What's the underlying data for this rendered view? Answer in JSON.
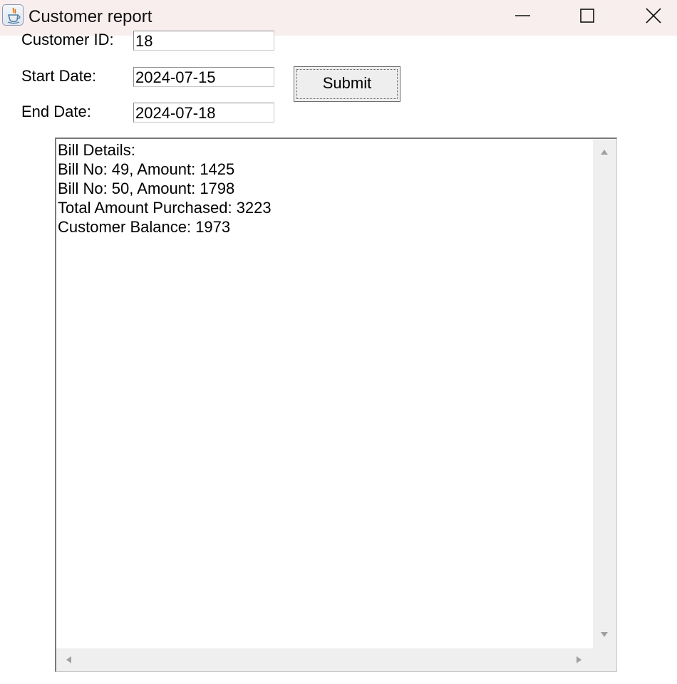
{
  "window": {
    "title": "Customer report",
    "app_icon": "java-icon"
  },
  "form": {
    "customer_id_label": "Customer ID:",
    "customer_id_value": "18",
    "start_date_label": "Start Date:",
    "start_date_value": "2024-07-15",
    "end_date_label": "End Date:",
    "end_date_value": "2024-07-18",
    "submit_label": "Submit"
  },
  "report": {
    "lines": [
      "Bill Details:",
      "Bill No: 49, Amount: 1425",
      "Bill No: 50, Amount: 1798",
      "Total Amount Purchased: 3223",
      "Customer Balance: 1973"
    ]
  },
  "colors": {
    "titlebar_bg": "#f9eeee",
    "button_bg": "#eeeeee",
    "scrollbar_bg": "#efefef"
  }
}
